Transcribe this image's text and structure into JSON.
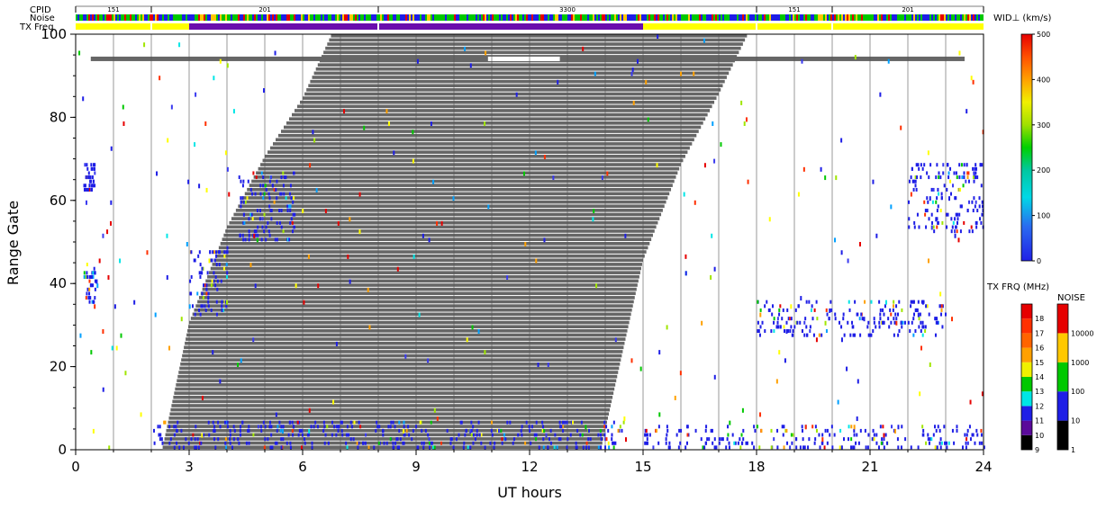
{
  "header": {
    "cpid_label": "CPID",
    "noise_label": "Noise",
    "txfreq_label": "TX Freq",
    "cpid_segments": [
      {
        "start": 0,
        "end": 2,
        "label": "151"
      },
      {
        "start": 2,
        "end": 8,
        "label": "201"
      },
      {
        "start": 8,
        "end": 18,
        "label": "3300"
      },
      {
        "start": 18,
        "end": 20,
        "label": "151"
      },
      {
        "start": 20,
        "end": 24,
        "label": "201"
      }
    ],
    "txfreq_segments": [
      {
        "start": 0,
        "end": 3,
        "color": "#ffff00"
      },
      {
        "start": 3,
        "end": 15,
        "color": "#6a0dad"
      },
      {
        "start": 15,
        "end": 24,
        "color": "#ffff00"
      }
    ]
  },
  "chart_data": {
    "type": "heatmap",
    "xlabel": "UT hours",
    "ylabel": "Range Gate",
    "xlim": [
      0,
      24
    ],
    "ylim": [
      0,
      100
    ],
    "xticks": [
      0,
      3,
      6,
      9,
      12,
      15,
      18,
      21,
      24
    ],
    "yticks": [
      0,
      20,
      40,
      60,
      80,
      100
    ],
    "hour_gridlines": true,
    "ground_scatter_color": "#666666",
    "ground_scatter_band": [
      {
        "x": 2.3,
        "gate": 0
      },
      {
        "x": 3.0,
        "gate": 30
      },
      {
        "x": 4.0,
        "gate": 53
      },
      {
        "x": 5.0,
        "gate": 70
      },
      {
        "x": 6.0,
        "gate": 84
      },
      {
        "x": 6.8,
        "gate": 100
      },
      {
        "x": 13.9,
        "gate": 0
      },
      {
        "x": 15.0,
        "gate": 45
      },
      {
        "x": 16.0,
        "gate": 68
      },
      {
        "x": 17.0,
        "gate": 85
      },
      {
        "x": 17.8,
        "gate": 100
      }
    ],
    "ground_scatter_gate94_line": {
      "start": 0.4,
      "end": 23.5,
      "gate": 94
    },
    "echo_clusters": [
      {
        "x": [
          3.0,
          4.0
        ],
        "gate": [
          32,
          48
        ]
      },
      {
        "x": [
          4.3,
          5.8
        ],
        "gate": [
          50,
          66
        ]
      },
      {
        "x": [
          0.2,
          0.5
        ],
        "gate": [
          62,
          68
        ]
      },
      {
        "x": [
          0.2,
          0.5
        ],
        "gate": [
          35,
          44
        ]
      },
      {
        "x": [
          18.0,
          23.0
        ],
        "gate": [
          27,
          35
        ]
      },
      {
        "x": [
          22.0,
          24.0
        ],
        "gate": [
          52,
          68
        ]
      },
      {
        "x": [
          2.0,
          14.5
        ],
        "gate": [
          0,
          6
        ]
      },
      {
        "x": [
          15.0,
          24.0
        ],
        "gate": [
          0,
          5
        ]
      }
    ],
    "width_colorbar": {
      "title": "WID⊥ (km/s)",
      "min": 0,
      "max": 500,
      "ticks": [
        0,
        100,
        200,
        300,
        400,
        500
      ]
    },
    "txfreq_colorbar": {
      "title": "TX FRQ (MHz)",
      "labels": [
        "9",
        "10",
        "11",
        "12",
        "13",
        "14",
        "15",
        "16",
        "17",
        "18"
      ],
      "colors": [
        "#000000",
        "#5a0a9a",
        "#1e1ee6",
        "#00e6e6",
        "#00c800",
        "#f0f000",
        "#ffa000",
        "#ff6400",
        "#ff3000",
        "#e60000"
      ]
    },
    "noise_colorbar": {
      "title": "NOISE",
      "labels": [
        "1",
        "10",
        "100",
        "1000",
        "10000"
      ],
      "colors": [
        "#000000",
        "#1e1ee6",
        "#00c800",
        "#ffc800",
        "#e60000"
      ]
    }
  }
}
